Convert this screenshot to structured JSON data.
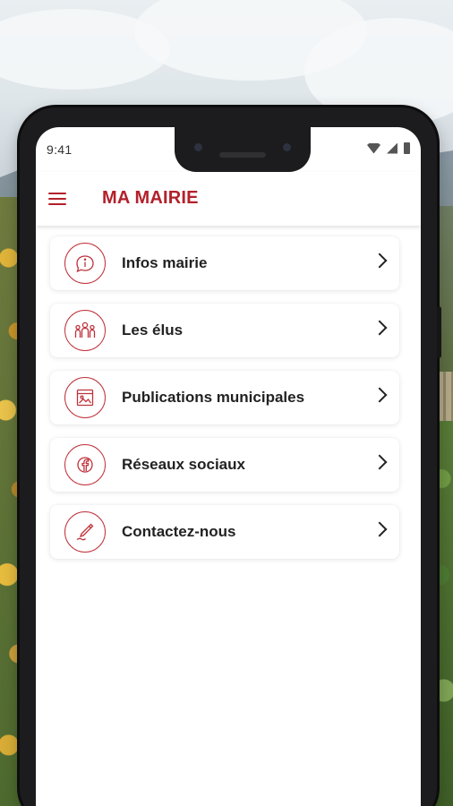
{
  "status_bar": {
    "time": "9:41",
    "icons": [
      "wifi-icon",
      "signal-icon",
      "battery-icon"
    ]
  },
  "app_bar": {
    "menu_icon": "hamburger-menu-icon",
    "title": "MA MAIRIE"
  },
  "menu": {
    "items": [
      {
        "label": "Infos mairie",
        "icon": "info-bubble-icon"
      },
      {
        "label": "Les élus",
        "icon": "people-group-icon"
      },
      {
        "label": "Publications municipales",
        "icon": "publication-image-icon"
      },
      {
        "label": "Réseaux sociaux",
        "icon": "facebook-icon"
      },
      {
        "label": "Contactez-nous",
        "icon": "pen-icon"
      }
    ]
  },
  "colors": {
    "accent": "#b3212b",
    "text": "#222222",
    "card_bg": "#ffffff"
  }
}
